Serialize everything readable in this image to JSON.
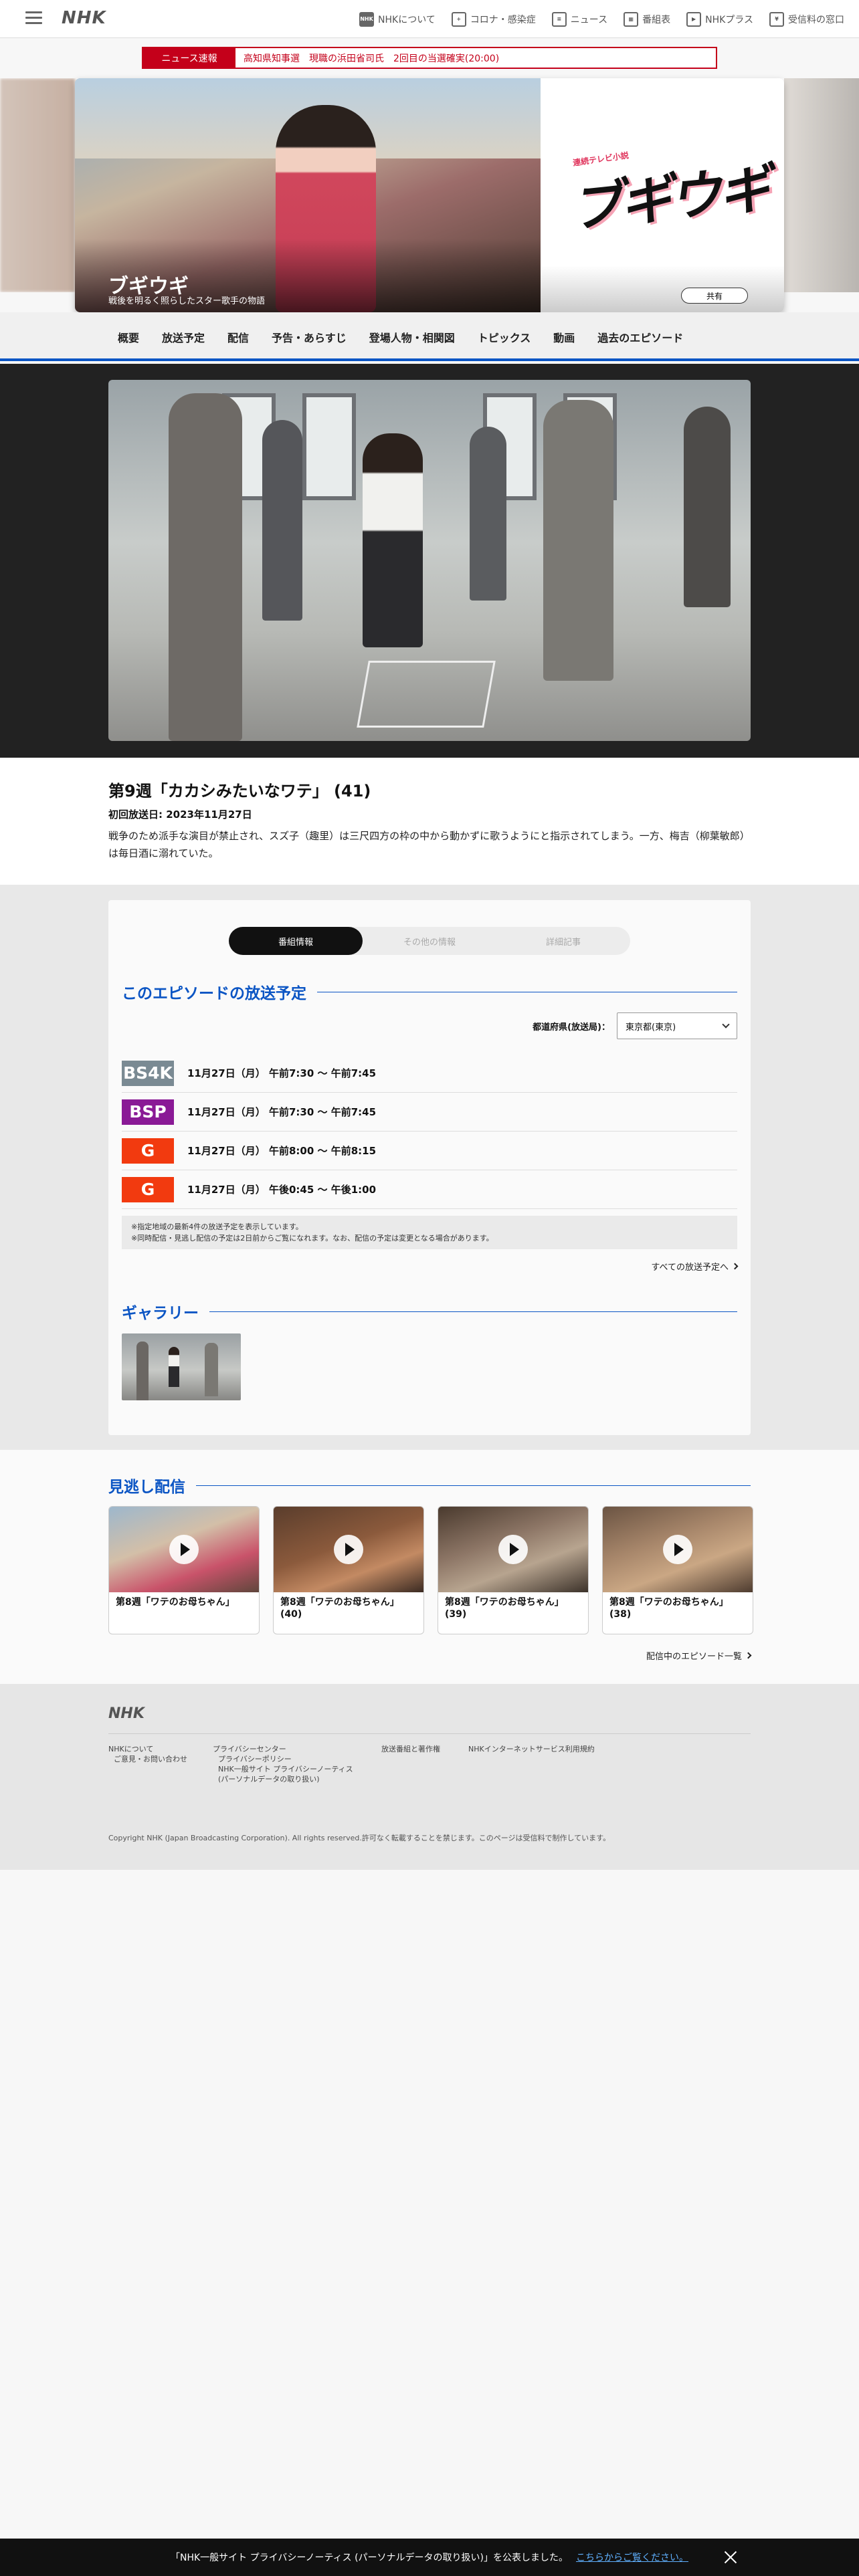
{
  "header": {
    "logo": "NHK",
    "nav": [
      {
        "label": "NHKについて",
        "icon": "nhk-icon"
      },
      {
        "label": "コロナ・感染症",
        "icon": "corona-icon"
      },
      {
        "label": "ニュース",
        "icon": "news-icon"
      },
      {
        "label": "番組表",
        "icon": "program-guide-icon"
      },
      {
        "label": "NHKプラス",
        "icon": "nhk-plus-icon"
      },
      {
        "label": "受信料の窓口",
        "icon": "reception-fee-icon"
      }
    ]
  },
  "breaking_news": {
    "label": "ニュース速報",
    "text": "高知県知事選　現職の浜田省司氏　2回目の当選確実(20:00)"
  },
  "hero": {
    "title": "ブギウギ",
    "subtitle": "戦後を明るく照らしたスター歌手の物語",
    "logo_sub": "連続テレビ小説",
    "logo_text": "ブギウギ",
    "share_label": "共有"
  },
  "program_nav": [
    "概要",
    "放送予定",
    "配信",
    "予告・あらすじ",
    "登場人物・相関図",
    "トピックス",
    "動画",
    "過去のエピソード"
  ],
  "episode": {
    "title": "第9週「カカシみたいなワテ」 (41)",
    "first_air": "初回放送日: 2023年11月27日",
    "description": "戦争のため派手な演目が禁止され、スズ子（趣里）は三尺四方の枠の中から動かずに歌うようにと指示されてしまう。一方、梅吉（柳葉敏郎）は毎日酒に溺れていた。"
  },
  "tabs": [
    "番組情報",
    "その他の情報",
    "詳細記事"
  ],
  "schedule": {
    "heading": "このエピソードの放送予定",
    "region_label": "都道府県(放送局)：",
    "region_value": "東京都(東京)",
    "rows": [
      {
        "channel": "BS4K",
        "color": "#7a8a93",
        "time": "11月27日（月） 午前7:30 ～ 午前7:45"
      },
      {
        "channel": "BSP",
        "color": "#8a1a96",
        "time": "11月27日（月） 午前7:30 ～ 午前7:45"
      },
      {
        "channel": "G",
        "color": "#f23a0f",
        "time": "11月27日（月） 午前8:00 ～ 午前8:15"
      },
      {
        "channel": "G",
        "color": "#f23a0f",
        "time": "11月27日（月） 午後0:45 ～ 午後1:00"
      }
    ],
    "note1": "※指定地域の最新4件の放送予定を表示しています。",
    "note2": "※同時配信・見逃し配信の予定は2日前からご覧になれます。なお、配信の予定は変更となる場合があります。",
    "more": "すべての放送予定へ"
  },
  "gallery": {
    "heading": "ギャラリー"
  },
  "missed": {
    "heading": "見逃し配信",
    "cards": [
      {
        "title": "第8週「ワテのお母ちゃん」"
      },
      {
        "title": "第8週「ワテのお母ちゃん」 (40)"
      },
      {
        "title": "第8週「ワテのお母ちゃん」 (39)"
      },
      {
        "title": "第8週「ワテのお母ちゃん」 (38)"
      }
    ],
    "more": "配信中のエピソード一覧"
  },
  "footer": {
    "logo": "NHK",
    "col1": [
      "NHKについて",
      "ご意見・お問い合わせ"
    ],
    "col2": [
      "プライバシーセンター",
      "プライバシーポリシー",
      "NHK一般サイト プライバシーノーティス",
      "(パーソナルデータの取り扱い)"
    ],
    "col3": [
      "放送番組と著作権"
    ],
    "col4": [
      "NHKインターネットサービス利用規約"
    ],
    "copyright": "Copyright NHK (Japan Broadcasting Corporation). All rights reserved.許可なく転載することを禁じます。このページは受信料で制作しています。"
  },
  "privacy_bar": {
    "text": "「NHK一般サイト プライバシーノーティス (パーソナルデータの取り扱い)」を公表しました。",
    "link": "こちらからご覧ください。"
  }
}
